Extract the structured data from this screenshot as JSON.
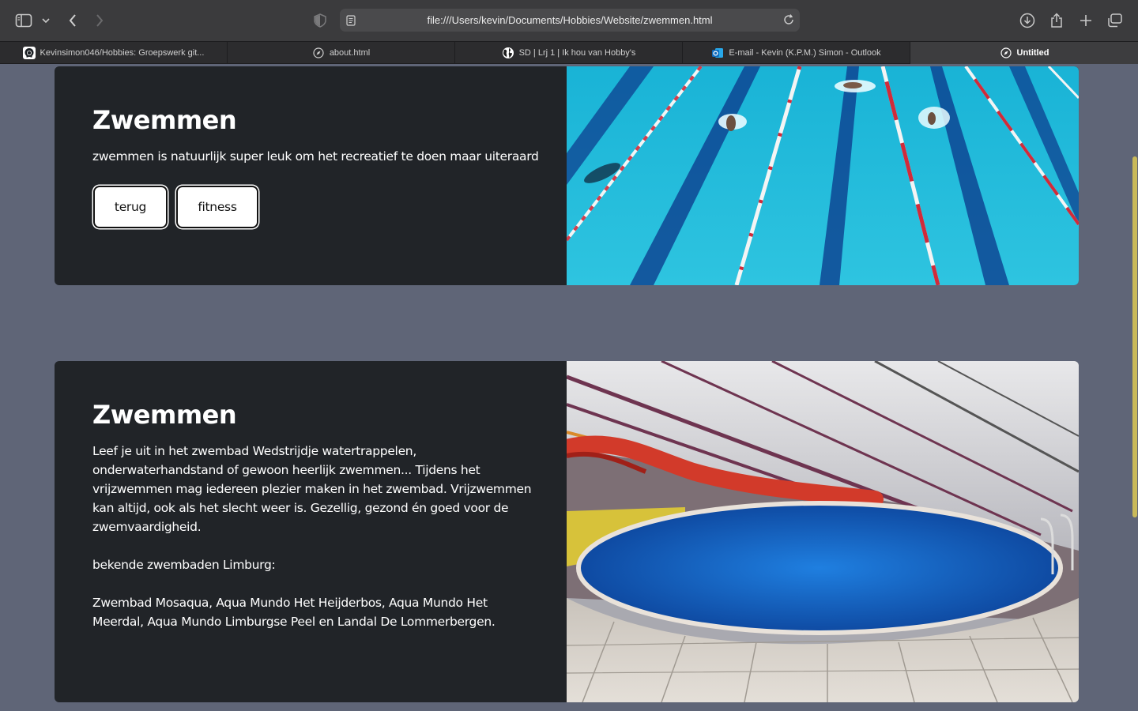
{
  "browser": {
    "url": "file:///Users/kevin/Documents/Hobbies/Website/zwemmen.html",
    "tabs": [
      {
        "label": "Kevinsimon046/Hobbies: Groepswerk git...",
        "icon": "github-icon"
      },
      {
        "label": "about.html",
        "icon": "compass-icon"
      },
      {
        "label": "SD | Lrj 1 | Ik hou van Hobby's",
        "icon": "globe-icon"
      },
      {
        "label": "E-mail - Kevin (K.P.M.) Simon - Outlook",
        "icon": "outlook-icon"
      },
      {
        "label": "Untitled",
        "icon": "compass-icon",
        "active": true
      }
    ]
  },
  "sections": [
    {
      "title": "Zwemmen",
      "paragraph": "zwemmen is natuurlijk super leuk om het recreatief te doen maar uiteraard",
      "buttons": [
        "terug",
        "fitness"
      ],
      "image": "outdoor-lap-pool-swimmers"
    },
    {
      "title": "Zwemmen",
      "paragraph": "Leef je uit in het zwembad Wedstrijdje watertrappelen, onderwaterhandstand of gewoon heerlijk zwemmen... Tijdens het vrijzwemmen mag iedereen plezier maken in het zwembad. Vrijzwemmen kan altijd, ook als het slecht weer is. Gezellig, gezond én goed voor de zwemvaardigheid.",
      "subheading": "bekende zwembaden Limburg:",
      "list_text": "Zwembad Mosaqua, Aqua Mundo Het Heijderbos, Aqua Mundo Het Meerdal, Aqua Mundo Limburgse Peel en Landal De Lommerbergen.",
      "image": "indoor-pool-with-slide"
    }
  ],
  "colors": {
    "page_bg": "#5f6577",
    "card_bg": "#212428",
    "pool_blue": "#1fb6d4"
  }
}
